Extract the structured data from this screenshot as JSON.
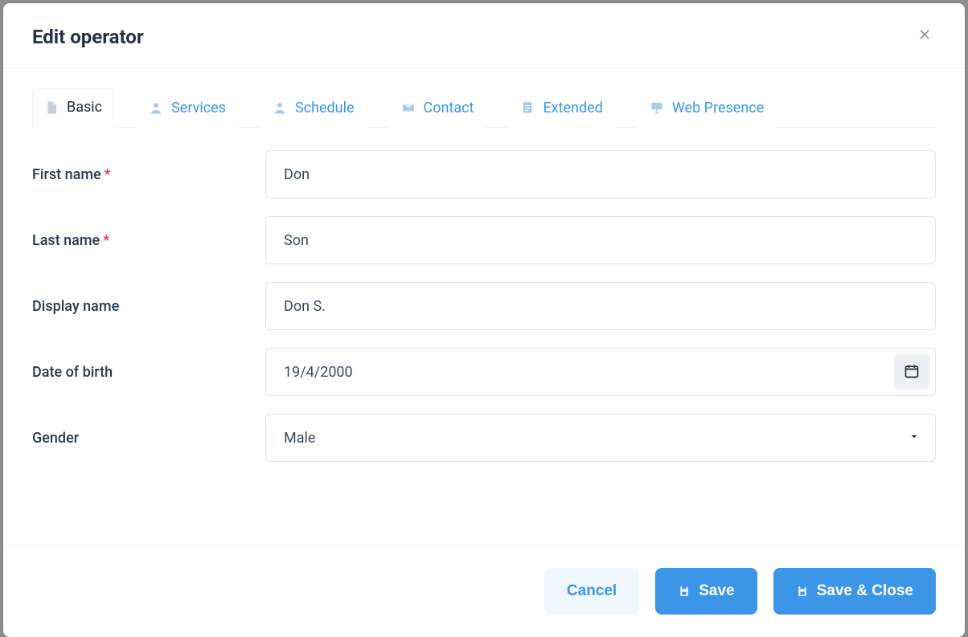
{
  "modal": {
    "title": "Edit operator"
  },
  "tabs": [
    {
      "label": "Basic"
    },
    {
      "label": "Services"
    },
    {
      "label": "Schedule"
    },
    {
      "label": "Contact"
    },
    {
      "label": "Extended"
    },
    {
      "label": "Web Presence"
    }
  ],
  "form": {
    "first_name": {
      "label": "First name",
      "value": "Don",
      "required": true
    },
    "last_name": {
      "label": "Last name",
      "value": "Son",
      "required": true
    },
    "display_name": {
      "label": "Display name",
      "value": "Don S."
    },
    "dob": {
      "label": "Date of birth",
      "value": "19/4/2000"
    },
    "gender": {
      "label": "Gender",
      "value": "Male"
    }
  },
  "footer": {
    "cancel": "Cancel",
    "save": "Save",
    "save_close": "Save & Close"
  }
}
